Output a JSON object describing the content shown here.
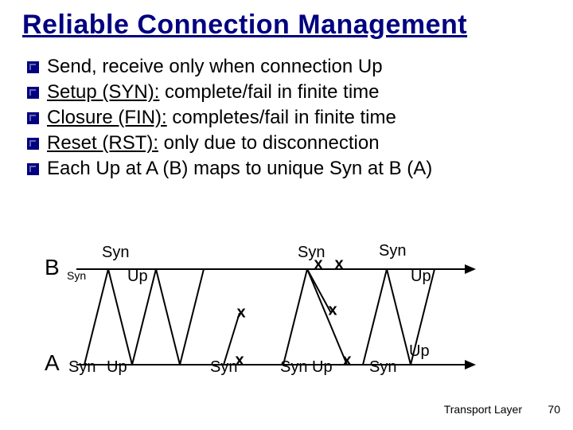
{
  "title": "Reliable Connection Management",
  "bullets": [
    {
      "pre": "",
      "u": "",
      "post": "Send, receive only when connection Up"
    },
    {
      "pre": "",
      "u": "Setup (SYN):",
      "post": " complete/fail in finite time"
    },
    {
      "pre": "",
      "u": "Closure (FIN):",
      "post": " completes/fail in finite time"
    },
    {
      "pre": "",
      "u": "Reset (RST):",
      "post": " only due to disconnection"
    },
    {
      "pre": "",
      "u": "",
      "post": "Each Up at A (B) maps to unique Syn at B (A)"
    }
  ],
  "diagram": {
    "host_B": "B",
    "host_A": "A",
    "labels": {
      "B_syn_small": "Syn",
      "B_syn1": "Syn",
      "B_up1": "Up",
      "B_syn2": "Syn",
      "B_syn3": "Syn",
      "B_up2": "Up",
      "A_syn1": "Syn",
      "A_up1": "Up",
      "A_syn2": "Syn",
      "A_syn3": "Syn",
      "A_up2": "Up",
      "A_syn4": "Syn",
      "A_up3": "Up"
    },
    "x_marks": [
      "x",
      "x",
      "x",
      "x",
      "x",
      "x"
    ]
  },
  "footer": "Transport Layer",
  "page": "70"
}
